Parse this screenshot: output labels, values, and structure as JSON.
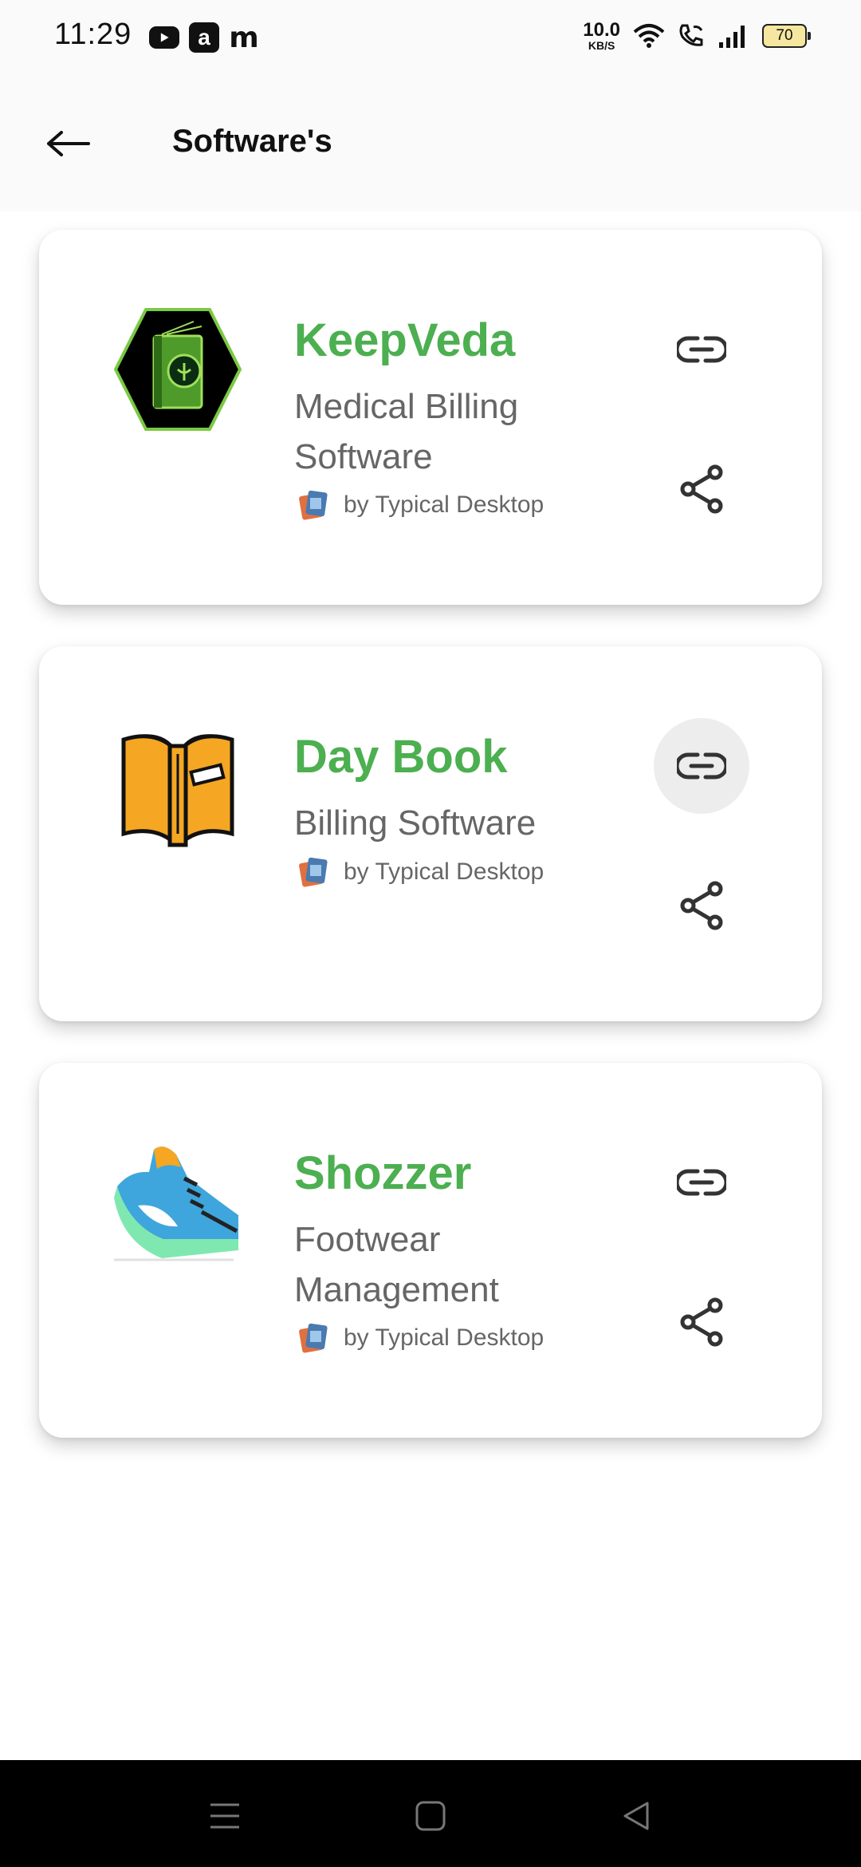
{
  "status_bar": {
    "time": "11:29",
    "net_speed_value": "10.0",
    "net_speed_unit": "KB/S",
    "battery": "70",
    "notification_icons": [
      "youtube-icon",
      "amazon-icon",
      "m-app-icon"
    ],
    "system_icons": [
      "wifi-icon",
      "wifi-call-icon",
      "signal-icon",
      "battery-icon"
    ]
  },
  "app_bar": {
    "title": "Software's"
  },
  "colors": {
    "accent_green": "#4caf50",
    "text_gray": "#666666",
    "icon_dark": "#333333"
  },
  "cards": [
    {
      "name": "KeepVeda",
      "description": "Medical Billing Software",
      "by": "by Typical Desktop",
      "logo": "keepveda-book-logo"
    },
    {
      "name": "Day Book",
      "description": "Billing Software",
      "by": "by Typical Desktop",
      "logo": "open-book-logo"
    },
    {
      "name": "Shozzer",
      "description": "Footwear Management",
      "by": "by Typical Desktop",
      "logo": "sneaker-logo"
    }
  ]
}
